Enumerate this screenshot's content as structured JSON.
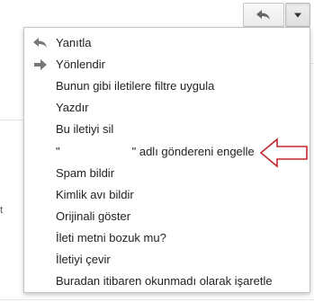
{
  "toolbar": {
    "reply_icon": "reply-icon",
    "more_icon": "chevron-down-icon"
  },
  "menu": {
    "items": [
      {
        "label": "Yanıtla",
        "icon": "reply-icon"
      },
      {
        "label": "Yönlendir",
        "icon": "forward-icon"
      },
      {
        "label": "Bunun gibi iletilere filtre uygula"
      },
      {
        "label": "Yazdır"
      },
      {
        "label": "Bu iletiyi sil"
      },
      {
        "label_prefix": "\"",
        "label_suffix": "\" adlı göndereni engelle"
      },
      {
        "label": "Spam bildir"
      },
      {
        "label": "Kimlik avı bildir"
      },
      {
        "label": "Orijinali göster"
      },
      {
        "label": "İleti metni bozuk mu?"
      },
      {
        "label": "İletiyi çevir"
      },
      {
        "label": "Buradan itibaren okunmadı olarak işaretle"
      }
    ]
  },
  "annotation": {
    "arrow_color": "#c0282d",
    "icon": "left-arrow-annotation-icon"
  },
  "background": {
    "edge_char": "t"
  }
}
